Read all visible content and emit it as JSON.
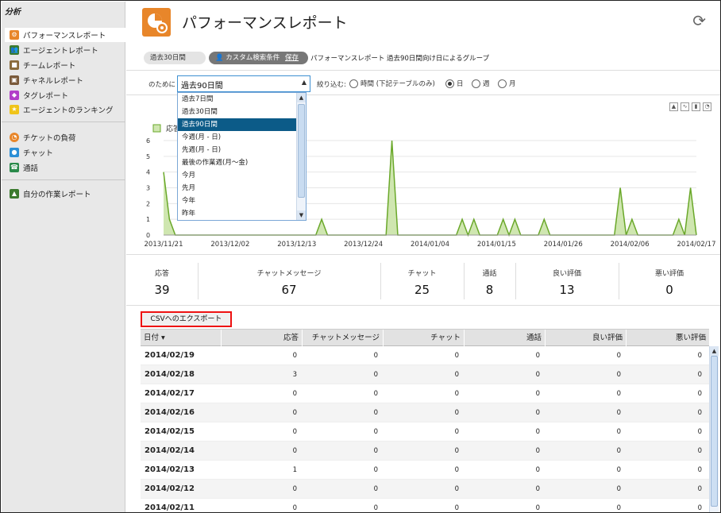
{
  "sidebar": {
    "title": "分析",
    "items": [
      {
        "label": "パフォーマンスレポート",
        "icon": "performance-icon",
        "color": "#e8862a",
        "active": true
      },
      {
        "label": "エージェントレポート",
        "icon": "agents-icon",
        "color": "#3b7a2e"
      },
      {
        "label": "チームレポート",
        "icon": "team-icon",
        "color": "#8a6b3b"
      },
      {
        "label": "チャネルレポート",
        "icon": "channel-icon",
        "color": "#7a5a3a"
      },
      {
        "label": "タグレポート",
        "icon": "tag-icon",
        "color": "#b23fc9"
      },
      {
        "label": "エージェントのランキング",
        "icon": "star-icon",
        "color": "#f0c419"
      },
      {
        "label": "チケットの負荷",
        "icon": "ticket-load-icon",
        "color": "#e8862a"
      },
      {
        "label": "チャット",
        "icon": "chat-icon",
        "color": "#2b8fd6"
      },
      {
        "label": "通話",
        "icon": "phone-icon",
        "color": "#2a8a4a"
      },
      {
        "label": "自分の作業レポート",
        "icon": "my-report-icon",
        "color": "#3b7a2e"
      }
    ]
  },
  "header": {
    "title": "パフォーマンスレポート",
    "refresh_icon": "refresh-icon"
  },
  "filters": {
    "pill_period": "過去30日間",
    "pill_custom": "カスタム検索条件",
    "pill_save": "保存",
    "grouping_text": "パフォーマンスレポート 過去90日間向け日によるグループ"
  },
  "period": {
    "label": "のために",
    "selected": "過去90日間",
    "options": [
      "過去7日間",
      "過去30日間",
      "過去90日間",
      "今週(月 - 日)",
      "先週(月 - 日)",
      "最後の作業週(月～金)",
      "今月",
      "先月",
      "今年",
      "昨年"
    ],
    "selected_index": 2
  },
  "narrow": {
    "label": "絞り込む:",
    "options": [
      {
        "label": "時間 (下記テーブルのみ)",
        "checked": false
      },
      {
        "label": "日",
        "checked": true
      },
      {
        "label": "週",
        "checked": false
      },
      {
        "label": "月",
        "checked": false
      }
    ]
  },
  "chart_data": {
    "type": "area",
    "legend": "応答",
    "ylim": [
      0,
      6
    ],
    "yticks": [
      "0",
      "1",
      "2",
      "3",
      "4",
      "5",
      "6"
    ],
    "x_tick_labels": [
      "2013/11/21",
      "2013/12/02",
      "2013/12/13",
      "2013/12/24",
      "2014/01/04",
      "2014/01/15",
      "2014/01/26",
      "2014/02/06",
      "2014/02/17"
    ],
    "x_start": "2013/11/21",
    "x_end": "2014/02/19",
    "series": [
      {
        "name": "応答",
        "color": "#6aa82a",
        "fill": "#cfe6b0",
        "values": [
          4,
          1,
          0,
          0,
          0,
          0,
          0,
          0,
          0,
          0,
          0,
          0,
          0,
          0,
          0,
          0,
          0,
          0,
          0,
          0,
          0,
          0,
          0,
          0,
          0,
          0,
          0,
          1,
          0,
          0,
          0,
          0,
          0,
          0,
          0,
          0,
          0,
          0,
          0,
          6,
          0,
          0,
          0,
          0,
          0,
          0,
          0,
          0,
          0,
          0,
          0,
          1,
          0,
          1,
          0,
          0,
          0,
          0,
          1,
          0,
          1,
          0,
          0,
          0,
          0,
          1,
          0,
          0,
          0,
          0,
          0,
          0,
          0,
          0,
          0,
          0,
          0,
          0,
          3,
          0,
          1,
          0,
          0,
          0,
          0,
          0,
          0,
          0,
          1,
          0,
          3,
          0
        ]
      }
    ]
  },
  "summary": [
    {
      "label": "応答",
      "value": "39"
    },
    {
      "label": "チャットメッセージ",
      "value": "67"
    },
    {
      "label": "チャット",
      "value": "25"
    },
    {
      "label": "通話",
      "value": "8"
    },
    {
      "label": "良い評価",
      "value": "13"
    },
    {
      "label": "悪い評価",
      "value": "0"
    }
  ],
  "table": {
    "export_label": "CSVへのエクスポート",
    "headers": [
      "日付",
      "応答",
      "チャットメッセージ",
      "チャット",
      "通話",
      "良い評価",
      "悪い評価"
    ],
    "rows": [
      [
        "2014/02/19",
        "0",
        "0",
        "0",
        "0",
        "0",
        "0"
      ],
      [
        "2014/02/18",
        "3",
        "0",
        "0",
        "0",
        "0",
        "0"
      ],
      [
        "2014/02/17",
        "0",
        "0",
        "0",
        "0",
        "0",
        "0"
      ],
      [
        "2014/02/16",
        "0",
        "0",
        "0",
        "0",
        "0",
        "0"
      ],
      [
        "2014/02/15",
        "0",
        "0",
        "0",
        "0",
        "0",
        "0"
      ],
      [
        "2014/02/14",
        "0",
        "0",
        "0",
        "0",
        "0",
        "0"
      ],
      [
        "2014/02/13",
        "1",
        "0",
        "0",
        "0",
        "0",
        "0"
      ],
      [
        "2014/02/12",
        "0",
        "0",
        "0",
        "0",
        "0",
        "0"
      ],
      [
        "2014/02/11",
        "0",
        "0",
        "0",
        "0",
        "0",
        "0"
      ]
    ]
  }
}
